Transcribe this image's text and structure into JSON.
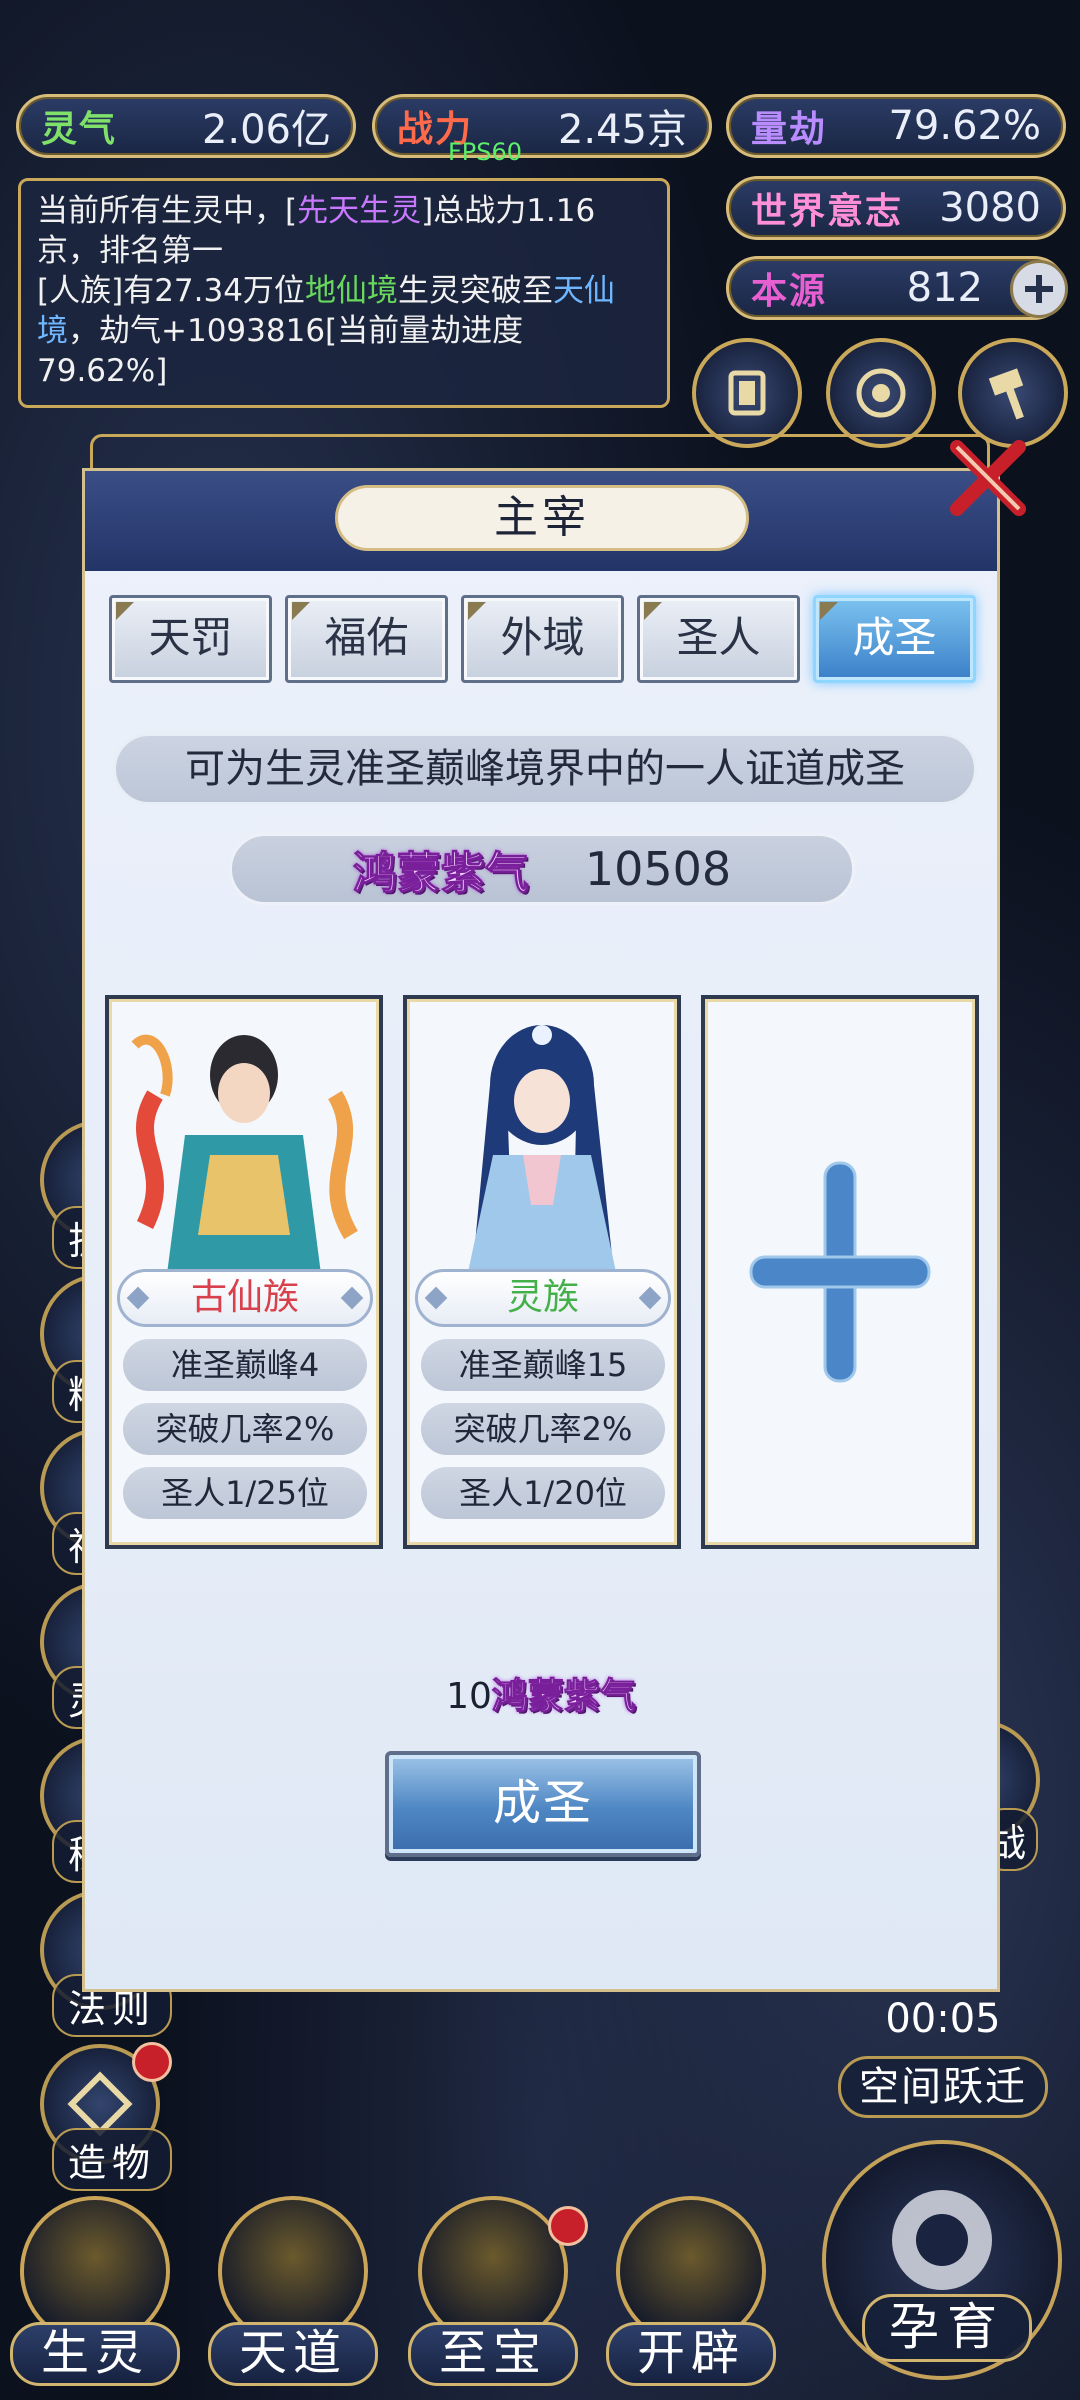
{
  "stats": {
    "lingqi": {
      "label": "灵气",
      "value": "2.06亿"
    },
    "zhanli": {
      "label": "战力",
      "value": "2.45京"
    },
    "liangjie": {
      "label": "量劫",
      "value": "79.62%"
    },
    "world": {
      "label": "世界意志",
      "value": "3080"
    },
    "benyuan": {
      "label": "本源",
      "value": "812"
    }
  },
  "fps": "FPS60",
  "log": {
    "line1_a": "当前所有生灵中，[",
    "line1_hl": "先天生灵",
    "line1_b": "]总战力1.16京，排名第一",
    "line2_a": "[人族]有27.34万位",
    "line2_green": "地仙境",
    "line2_b": "生灵突破至",
    "line2_blue": "天仙境",
    "line2_c": "，劫气+1093816[当前量劫进度79.62%]"
  },
  "side_menu": [
    "护",
    "精",
    "神",
    "灵",
    "秘",
    "法则",
    "造物"
  ],
  "right_menu": [
    "战"
  ],
  "modal": {
    "title": "主宰",
    "tabs": [
      "天罚",
      "福佑",
      "外域",
      "圣人",
      "成圣"
    ],
    "active_tab": 4,
    "description": "可为生灵准圣巅峰境界中的一人证道成圣",
    "currency_name": "鸿蒙紫气",
    "currency_amount": "10508",
    "candidates": [
      {
        "tribe": "古仙族",
        "tribe_color": "#d8404c",
        "realm": "准圣巅峰4",
        "rate": "突破几率2%",
        "saint": "圣人1/25位"
      },
      {
        "tribe": "灵族",
        "tribe_color": "#43b04a",
        "realm": "准圣巅峰15",
        "rate": "突破几率2%",
        "saint": "圣人1/20位"
      }
    ],
    "cost_amount": "10",
    "cost_name": "鸿蒙紫气",
    "confirm_label": "成圣"
  },
  "timer": {
    "time": "00:05",
    "label": "空间跃迁"
  },
  "bottom_nav": [
    "生灵",
    "天道",
    "至宝",
    "开辟"
  ],
  "main_action": "孕育"
}
